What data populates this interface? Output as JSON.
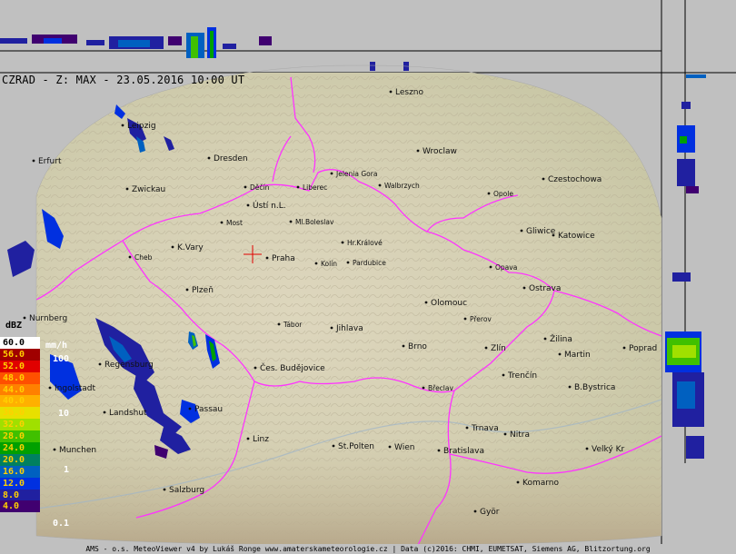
{
  "title": "CZRAD - Z: MAX - 23.05.2016 10:00 UT",
  "footer": "AMS - o.s. MeteoViewer v4 by Lukáš Ronge www.amaterskameteorologie.cz | Data (c)2016: CHMI, EUMETSAT, Siemens AG, Blitzortung.org",
  "legend": {
    "unit_label": "dBZ",
    "rate_unit": "mm/h",
    "rate_marks": [
      "100",
      "10",
      "1",
      "0.1"
    ],
    "levels": [
      {
        "value": "60.0",
        "color": "#ffffff",
        "text": "#000000"
      },
      {
        "value": "56.0",
        "color": "#a00000",
        "text": "#ffd000"
      },
      {
        "value": "52.0",
        "color": "#e00000",
        "text": "#ffd000"
      },
      {
        "value": "48.0",
        "color": "#ff5000",
        "text": "#ffd000"
      },
      {
        "value": "44.0",
        "color": "#ff8000",
        "text": "#ffd000"
      },
      {
        "value": "40.0",
        "color": "#ffb000",
        "text": "#ffd000"
      },
      {
        "value": "36.0",
        "color": "#e8e000",
        "text": "#ffd000"
      },
      {
        "value": "32.0",
        "color": "#a0e000",
        "text": "#ffd000"
      },
      {
        "value": "28.0",
        "color": "#40c000",
        "text": "#ffd000"
      },
      {
        "value": "24.0",
        "color": "#00a000",
        "text": "#ffd000"
      },
      {
        "value": "20.0",
        "color": "#008060",
        "text": "#ffd000"
      },
      {
        "value": "16.0",
        "color": "#0060c0",
        "text": "#ffd000"
      },
      {
        "value": "12.0",
        "color": "#0030e0",
        "text": "#ffd000"
      },
      {
        "value": "8.0",
        "color": "#2020a0",
        "text": "#ffd000"
      },
      {
        "value": "4.0",
        "color": "#400070",
        "text": "#ffd000"
      }
    ]
  },
  "cities": [
    {
      "name": "Leszno"
    },
    {
      "name": "Leipzig"
    },
    {
      "name": "Dresden"
    },
    {
      "name": "Wroclaw"
    },
    {
      "name": "Erfurt"
    },
    {
      "name": "Jelenia Gora"
    },
    {
      "name": "Walbrzych"
    },
    {
      "name": "Czestochowa"
    },
    {
      "name": "Zwickau"
    },
    {
      "name": "Děčín"
    },
    {
      "name": "Liberec"
    },
    {
      "name": "Opole"
    },
    {
      "name": "Ústí n.L."
    },
    {
      "name": "Most"
    },
    {
      "name": "Ml.Boleslav"
    },
    {
      "name": "Gliwice"
    },
    {
      "name": "Katowice"
    },
    {
      "name": "K.Vary"
    },
    {
      "name": "Hr.Králové"
    },
    {
      "name": "Cheb"
    },
    {
      "name": "Praha"
    },
    {
      "name": "Kolín"
    },
    {
      "name": "Pardubice"
    },
    {
      "name": "Opava"
    },
    {
      "name": "Plzeň"
    },
    {
      "name": "Ostrava"
    },
    {
      "name": "Olomouc"
    },
    {
      "name": "Nurnberg"
    },
    {
      "name": "Přerov"
    },
    {
      "name": "Tábor"
    },
    {
      "name": "Jihlava"
    },
    {
      "name": "Žilina"
    },
    {
      "name": "Brno"
    },
    {
      "name": "Zlín"
    },
    {
      "name": "Martin"
    },
    {
      "name": "Poprad"
    },
    {
      "name": "Regensburg"
    },
    {
      "name": "Čes. Budějovice"
    },
    {
      "name": "Trenčín"
    },
    {
      "name": "Ingolstadt"
    },
    {
      "name": "Břeclav"
    },
    {
      "name": "B.Bystrica"
    },
    {
      "name": "Landshut"
    },
    {
      "name": "Passau"
    },
    {
      "name": "Trnava"
    },
    {
      "name": "Linz"
    },
    {
      "name": "Nitra"
    },
    {
      "name": "Munchen"
    },
    {
      "name": "St.Polten"
    },
    {
      "name": "Wien"
    },
    {
      "name": "Bratislava"
    },
    {
      "name": "Velký Kr"
    },
    {
      "name": "Komarno"
    },
    {
      "name": "Salzburg"
    },
    {
      "name": "Györ"
    }
  ]
}
